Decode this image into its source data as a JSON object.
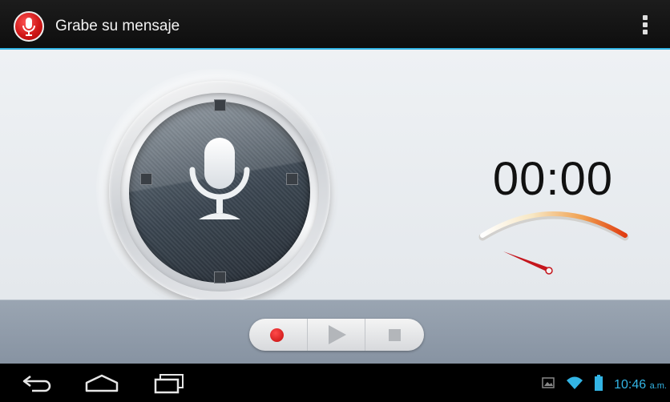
{
  "action_bar": {
    "title": "Grabe su mensaje",
    "app_icon": "microphone-icon",
    "overflow_icon": "overflow-menu-icon"
  },
  "recorder": {
    "timer": "00:00",
    "dial_icon": "microphone-icon",
    "level_meter_icon": "vu-meter-icon"
  },
  "controls": {
    "record_icon": "record-icon",
    "play_icon": "play-icon",
    "stop_icon": "stop-icon"
  },
  "system_bar": {
    "back_icon": "back-icon",
    "home_icon": "home-icon",
    "recent_icon": "recent-apps-icon",
    "gallery_icon": "gallery-icon",
    "wifi_icon": "wifi-icon",
    "battery_icon": "battery-icon",
    "clock_time": "10:46",
    "clock_ampm": "a.m."
  },
  "colors": {
    "accent": "#33b5e5",
    "record_red": "#e01b1b",
    "control_bar": "#8f9baa"
  }
}
